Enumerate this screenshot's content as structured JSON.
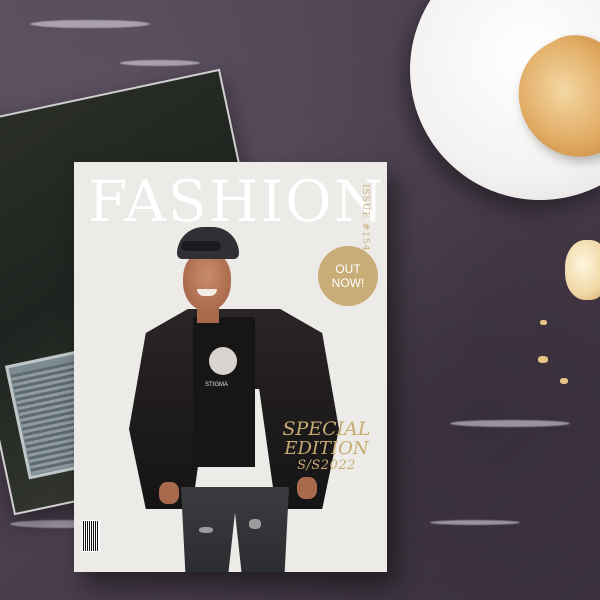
{
  "magazine": {
    "title": "FASHION",
    "issue_label": "ISSUE #154",
    "badge": {
      "line1": "OUT",
      "line2": "NOW!"
    },
    "special": {
      "line1": "SPECIAL",
      "line2": "EDITION",
      "season": "S/S2022"
    },
    "shirt_text": "STIGMA"
  },
  "icons": {
    "barcode": "barcode-icon",
    "plate": "plate",
    "pastry": "pastry"
  },
  "colors": {
    "table": "#4a3f4a",
    "cover": "#ecebe7",
    "gold": "#c8ad77"
  }
}
